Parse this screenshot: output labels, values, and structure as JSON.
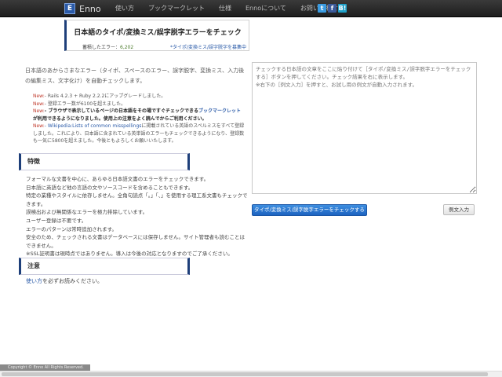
{
  "navbar": {
    "brand_letter": "E",
    "brand_name": "Enno",
    "items": [
      "使い方",
      "ブックマークレット",
      "仕様",
      "Ennoについて",
      "お問い合わせ"
    ],
    "social": [
      {
        "icon": "twitter-icon",
        "glyph": "t"
      },
      {
        "icon": "facebook-icon",
        "glyph": "f"
      },
      {
        "icon": "hatena-icon",
        "glyph": "B!"
      }
    ]
  },
  "header": {
    "title": "日本語のタイポ/変換ミス/誤字脱字エラーをチェック",
    "count_label": "蓄積したエラー：",
    "count_value": "6,202",
    "missing_link": "*タイポ/変換ミス/誤字脱字を募集中"
  },
  "intro": "日本語のあからさまなエラー（タイポ、スペースのエラー、誤字脱字、変換ミス、入力後の編集ミス、文字化け）を自動チェックします。",
  "news": {
    "new_label": "New:",
    "item1": "- Rails 4.2.3 + Ruby 2.2.2にアップグレードしました。",
    "item2": "- 登録エラー数が6100を超えました。",
    "item3_a": "- ブラウザで表示しているページの日本語をその場ですぐチェックできる",
    "item3_link": "ブックマークレット",
    "item3_b": "が利用できるようになりました。使用上の注意をよく読んでからご利用ください。",
    "item4_link": "- Wikipedia:Lists of common misspellings",
    "item4_text": "に掲載されている英語のスペルミスをすべて登録しました。これにより、日本語に含まれている英単語のエラーもチェックできるようになり、登録数も一気に5800を超えました。今後ともよろしくお願いいたします。"
  },
  "features": {
    "heading": "特徴",
    "lines": [
      "フォーマルな文書を中心に、あらゆる日本語文書のエラーをチェックできます。",
      "日本語に英語など他の言語の文やソースコードを含めることもできます。",
      "特定の業種やスタイルに依存しません。全角句読点「。」「、」を使用する理工系文書もチェックできます。",
      "誤検出および無関係なエラーを極力排除しています。",
      "ユーザー登録は不要です。",
      "エラーのパターンは常時追加されます。",
      "安全のため、チェックされる文書はデータベースには保存しません。サイト管理者も読むことはできません。",
      "※SSL証明書は現時点ではありません。導入は今後の対応となりますのでご了承ください。"
    ]
  },
  "note": {
    "heading": "注意",
    "link": "使い方",
    "text": "を必ずお読みください。"
  },
  "input": {
    "placeholder": "チェックする日本語の文章をここに貼り付けて［タイポ/変換ミス/誤字脱字エラーをチェックする］ボタンを押してください。チェック結果を右に表示します。\n※右下の［例文入力］を押すと、お試し用の例文が自動入力されます。"
  },
  "buttons": {
    "check": "タイポ/変換ミス/誤字脱字エラーをチェックする",
    "example": "例文入力"
  },
  "footer": {
    "copyright": "Copyright © Enno All Rights Reserved."
  }
}
